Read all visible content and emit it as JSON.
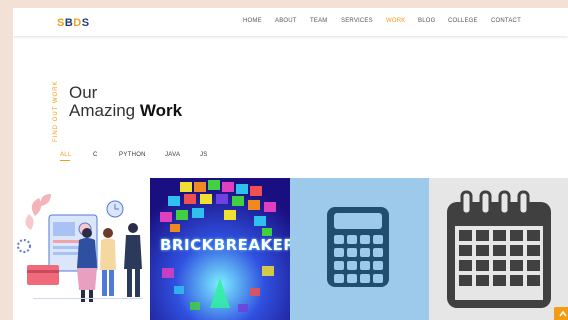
{
  "brand": {
    "s": "S",
    "b": "B",
    "d": "D",
    "s2": "S"
  },
  "nav": {
    "items": [
      {
        "label": "HOME"
      },
      {
        "label": "ABOUT"
      },
      {
        "label": "TEAM"
      },
      {
        "label": "SERVICES"
      },
      {
        "label": "WORK"
      },
      {
        "label": "BLOG"
      },
      {
        "label": "COLLEGE"
      },
      {
        "label": "CONTACT"
      }
    ],
    "active": "WORK"
  },
  "section": {
    "eyebrow": "FIND OUT WORK",
    "title_line1": "Our",
    "title_line2_prefix": "Amazing ",
    "title_line2_bold": "Work"
  },
  "filters": {
    "items": [
      {
        "label": "ALL"
      },
      {
        "label": "C"
      },
      {
        "label": "PYTHON"
      },
      {
        "label": "JAVA"
      },
      {
        "label": "JS"
      }
    ],
    "active": "ALL"
  },
  "portfolio": {
    "tiles": [
      {
        "icon": "people-dashboard-illustration"
      },
      {
        "title": "BRICKBREAKER"
      },
      {
        "icon": "calculator-icon"
      },
      {
        "icon": "calendar-icon"
      }
    ]
  },
  "colors": {
    "accent": "#f39c12",
    "brand_blue": "#203c7a",
    "calculator_bg": "#9dcaea",
    "calculator_fg": "#1f4e6e",
    "calendar_fg": "#404040"
  },
  "scroll_top": {
    "icon": "chevron-up-icon"
  }
}
